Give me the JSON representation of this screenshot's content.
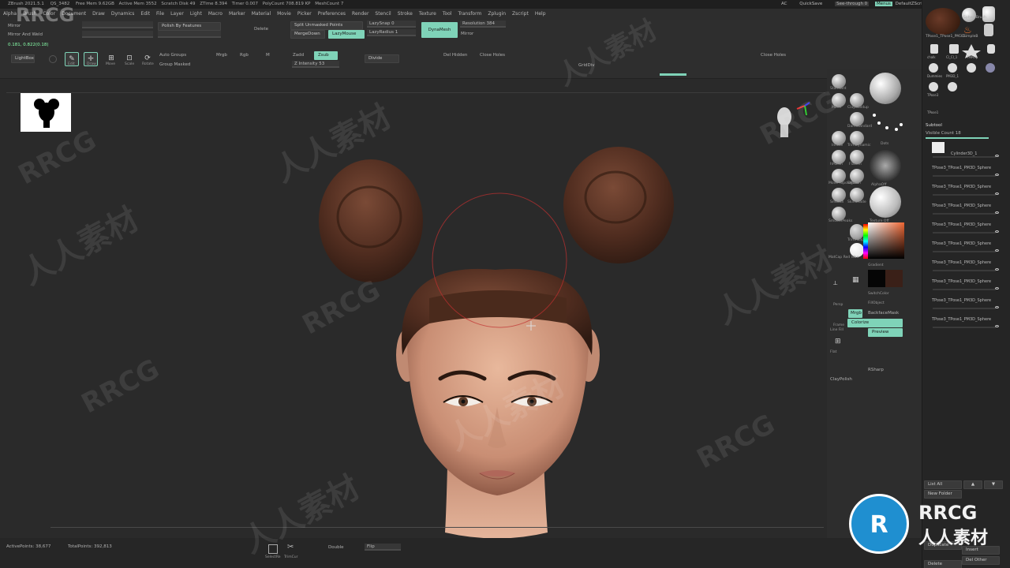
{
  "title_bar": {
    "app": "ZBrush 2021.5.1",
    "fields": [
      "QS_3482",
      "Free Mem 9.62GB",
      "Active Mem 3552",
      "Scratch Disk 49",
      "ZTime 8.394",
      "Timer 0.007",
      "PolyCount 708.819 KP",
      "MeshCount 7"
    ],
    "right_items": [
      "AC",
      "QuickSave",
      "See-through 0",
      "Menus",
      "DefaultZScript"
    ]
  },
  "menu": [
    "Alpha",
    "Brush",
    "Color",
    "Document",
    "Draw",
    "Dynamics",
    "Edit",
    "File",
    "Layer",
    "Light",
    "Macro",
    "Marker",
    "Material",
    "Movie",
    "Picker",
    "Preferences",
    "Render",
    "Stencil",
    "Stroke",
    "Texture",
    "Tool",
    "Transform",
    "Zplugin",
    "Zscript",
    "Help"
  ],
  "top_shelf": {
    "mirror": "Mirror",
    "mirror_weld": "Mirror And Weld",
    "coords": "0.181, 0.822(0.18)",
    "lightbox": "LightBox",
    "polish_by_features": "Polish By Features",
    "delete": "Delete",
    "split_unmasked": "Split Unmasked Points",
    "merge_down": "MergeDown",
    "lazy_mouse": "LazyMouse",
    "lazy_snap": "LazySnap 0",
    "lazy_radius": "LazyRadius 1",
    "dynamesh": "DynaMesh",
    "resolution": "Resolution 384",
    "mirror2": "Mirror",
    "auto_groups": "Auto Groups",
    "group_masked": "Group Masked",
    "mrgb": "Mrgb",
    "rgb": "Rgb",
    "m": "M",
    "zadd": "Zadd",
    "zsub": "Zsub",
    "z_intensity": "Z Intensity 53",
    "divide": "Divide",
    "del_hidden": "Del Hidden",
    "close_holes": "Close Holes",
    "close_holes2": "Close Holes",
    "gridDiv": "GridDiv",
    "tools": [
      {
        "icon": "edit-icon",
        "label": "Edit"
      },
      {
        "icon": "draw-icon",
        "label": "Draw"
      },
      {
        "icon": "move-icon",
        "label": "Move"
      },
      {
        "icon": "scale-icon",
        "label": "Scale"
      },
      {
        "icon": "rotate-icon",
        "label": "Rotate"
      }
    ]
  },
  "right_shelf": {
    "brushes": [
      "Standard",
      "Move",
      "ClayBuildup",
      "DamStandard",
      "Inflate",
      "TrimDynamic",
      "hPolish",
      "Flatten",
      "Move Topological",
      "SMooth",
      "Smooth",
      "SkinShade",
      "SmoothPeaks",
      "TrimAdaptive"
    ],
    "dots_label": "Dots",
    "alpha_off": "AlphaOff",
    "texture_off": "Texture Off",
    "material": "MatCap Red Wax",
    "gradient": "Gradient",
    "switch_color": "SwitchColor",
    "fill_object": "FillObject",
    "mrgb": "Mrgb",
    "backface_mask": "BackfaceMask",
    "colorize": "Colorize",
    "preview": "Preview",
    "persp": "Persp",
    "floor": "Floor",
    "frame": "Frame",
    "line_fill": "Line Fill",
    "transp": "Transp",
    "flat": "Flat",
    "rsharp": "RSharp",
    "claypolish": "ClayPolish"
  },
  "right_panel": {
    "tool_thumbs": [
      "TPose1_TPose1_PM3D",
      "SphereBrush",
      "PolyMesh",
      "SimpleB",
      "Cylinder",
      "chalk",
      "Cl_Cl_1",
      "TMPoly",
      "TPose1",
      "Dummies",
      "PM3D_1",
      "Cl_PoleCl_1",
      "TPose3",
      "TPose3_PM3D",
      "TPose3",
      "TPose1",
      "TPose1"
    ],
    "subtool_header": "Subtool",
    "visible_count": "Visible Count 18",
    "subtools": [
      "Cylinder3D_1",
      "TPose3_TPose1_PM3D_Sphere",
      "TPose3_TPose1_PM3D_Sphere",
      "TPose3_TPose1_PM3D_Sphere",
      "TPose3_TPose1_PM3D_Sphere",
      "TPose3_TPose1_PM3D_Sphere",
      "TPose3_TPose1_PM3D_Sphere",
      "TPose3_TPose1_PM3D_Sphere",
      "TPose3_TPose1_PM3D_Sphere",
      "TPose3_TPose1_PM3D_Sphere"
    ],
    "list_all": "List All",
    "new_folder": "New Folder",
    "duplicate": "Duplicate",
    "insert": "Insert",
    "delete": "Delete",
    "del_other": "Del Other"
  },
  "bottom": {
    "active_points": "ActivePoints: 38,677",
    "total_points": "TotalPoints: 392,813",
    "selectrect": "SelectRe",
    "trimcurve": "TrimCur",
    "double": "Double",
    "flip": "Flip"
  },
  "watermarks": {
    "rrcg": "RRCG",
    "cn": "人人素材"
  },
  "logo": {
    "rrcg": "RRCG",
    "cn": "人人素材"
  },
  "colors": {
    "accent": "#7fd3b8",
    "hair": "#5a3324",
    "skin": "#d9a58a",
    "bg": "#2a2a2a"
  }
}
